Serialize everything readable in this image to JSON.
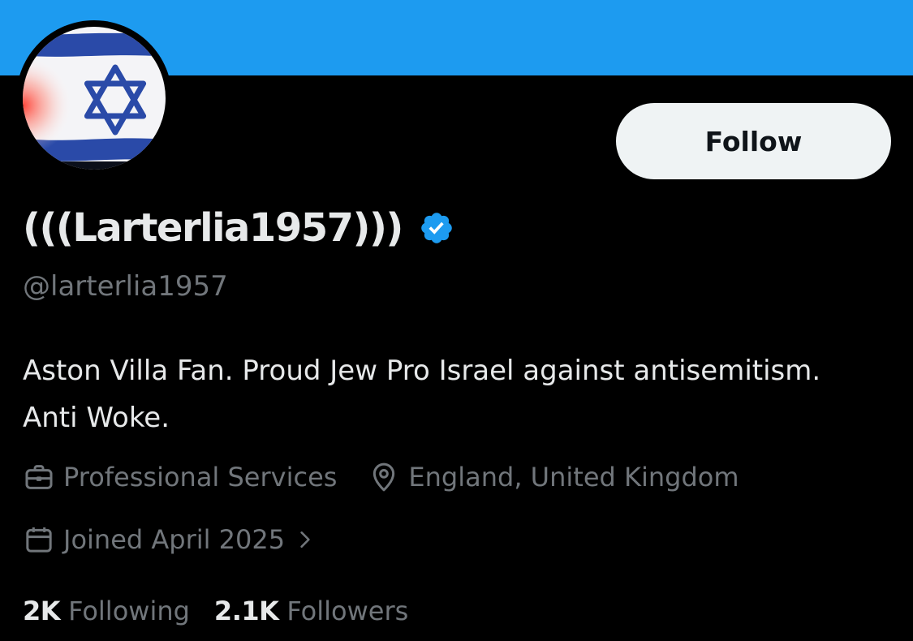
{
  "theme": {
    "banner_color": "#1d9bf0",
    "background": "#000000",
    "primary_text": "#e7e9ea",
    "secondary_text": "#71767b",
    "verified_color": "#1d9bf0",
    "follow_button_bg": "#eff3f4"
  },
  "profile": {
    "avatar_icon": "israel-flag-avatar",
    "display_name": "(((Larterlia1957)))",
    "verified_icon": "verified-badge-icon",
    "handle": "@larterlia1957",
    "bio": "Aston Villa Fan. Proud Jew Pro Israel against antisemitism. Anti Woke.",
    "category": {
      "icon": "briefcase-icon",
      "label": "Professional Services"
    },
    "location": {
      "icon": "location-pin-icon",
      "label": "England, United Kingdom"
    },
    "joined": {
      "icon": "calendar-icon",
      "label": "Joined April 2025"
    }
  },
  "actions": {
    "follow_label": "Follow"
  },
  "stats": {
    "following_count": "2K",
    "following_label": "Following",
    "followers_count": "2.1K",
    "followers_label": "Followers"
  }
}
